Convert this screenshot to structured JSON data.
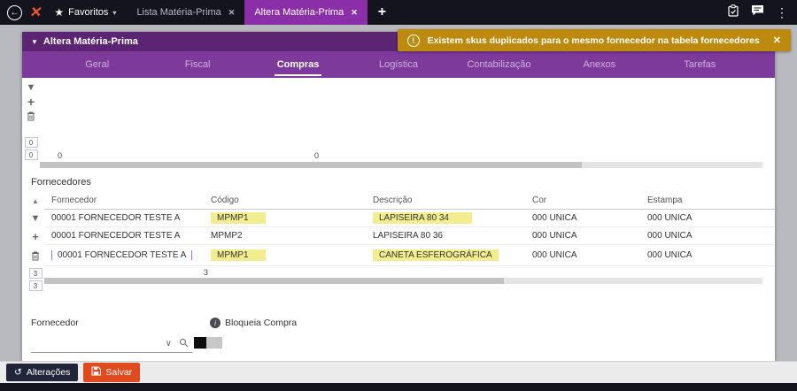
{
  "colors": {
    "accent_purple": "#7d3a9a",
    "title_purple": "#5b2573",
    "active_tab_purple": "#8b2fa8",
    "toast_amber": "#bd8a0e",
    "save_orange": "#df4a1e",
    "alteracoes_dark": "#20253a",
    "highlight_yellow": "#f2ee8f"
  },
  "icons": {
    "back": "←",
    "star": "★",
    "fav_caret": "▾",
    "close": "✕",
    "plus": "+",
    "dots": "⋮",
    "caret_down": "▼",
    "caret_up": "▲",
    "chevron_down": "∨",
    "undo": "↺",
    "info": "i",
    "warn": "!"
  },
  "topbar": {
    "favorites_label": "Favoritos",
    "tabs": [
      {
        "label": "Lista Matéria-Prima",
        "active": false
      },
      {
        "label": "Altera Matéria-Prima",
        "active": true
      }
    ]
  },
  "toast": {
    "message": "Existem skus duplicados para o mesmo fornecedor na tabela fornecedores"
  },
  "panel": {
    "title": "Altera Matéria-Prima",
    "active_tab": "Compras",
    "tabs": [
      "Geral",
      "Fiscal",
      "Compras",
      "Logística",
      "Contabilização",
      "Anexos",
      "Tarefas"
    ]
  },
  "upper_grid": {
    "row_numbers": [
      "0",
      "0"
    ],
    "footer_values": [
      "0",
      "0"
    ]
  },
  "suppliers": {
    "section_title": "Fornecedores",
    "columns": [
      "Fornecedor",
      "Código",
      "Descrição",
      "Cor",
      "Estampa"
    ],
    "rows": [
      {
        "fornecedor": "00001 FORNECEDOR TESTE A",
        "codigo": "MPMP1",
        "descricao": "LAPISEIRA 80 34",
        "cor": "000 UNICA",
        "estampa": "000 UNICA"
      },
      {
        "fornecedor": "00001 FORNECEDOR TESTE A",
        "codigo": "MPMP2",
        "descricao": "LAPISEIRA 80 36",
        "cor": "000 UNICA",
        "estampa": "000 UNICA"
      },
      {
        "fornecedor": "00001 FORNECEDOR TESTE A",
        "codigo": "MPMP1",
        "descricao": "CANETA ESFEROGRÁFICA",
        "cor": "000 UNICA",
        "estampa": "000 UNICA"
      }
    ],
    "row_numbers": [
      "3",
      "3"
    ],
    "footer_value": "3"
  },
  "form": {
    "fornecedor_label": "Fornecedor",
    "bloqueia_label": "Bloqueia Compra"
  },
  "footer": {
    "alteracoes_label": "Alterações",
    "salvar_label": "Salvar"
  }
}
